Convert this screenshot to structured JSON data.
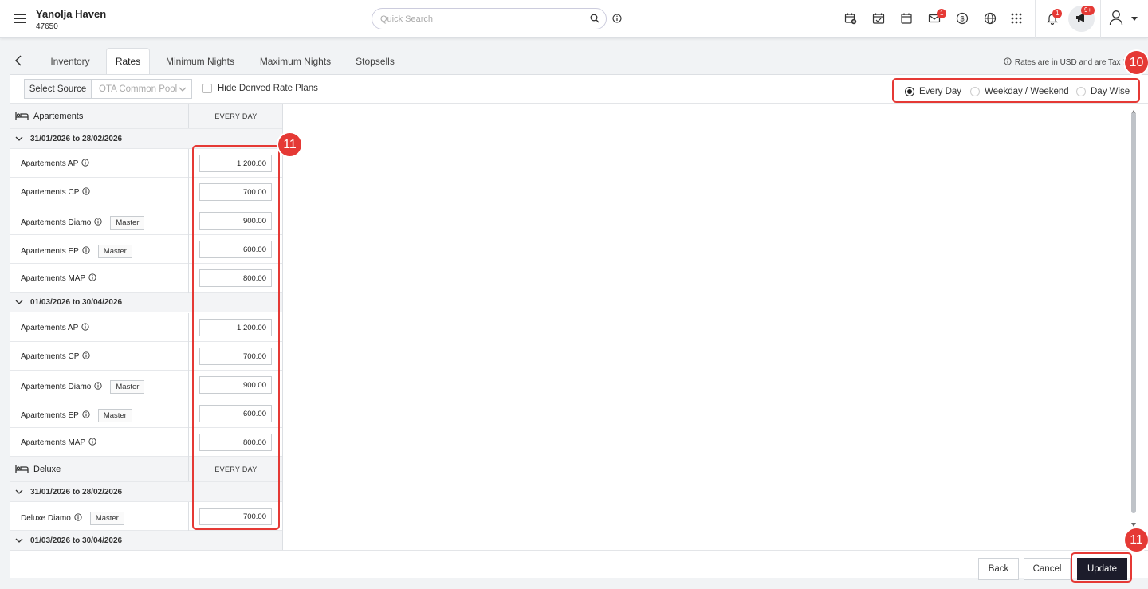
{
  "header": {
    "hotel_name": "Yanolja Haven",
    "hotel_id": "47650",
    "search_placeholder": "Quick Search",
    "mail_badge": "1",
    "notif_badge": "1",
    "announce_badge": "9+"
  },
  "tabs": [
    "Inventory",
    "Rates",
    "Minimum Nights",
    "Maximum Nights",
    "Stopsells"
  ],
  "active_tab": "Rates",
  "note": "Rates are in USD and are Tax Exclusi",
  "filter": {
    "select_source": "Select Source",
    "source_value": "OTA Common Pool",
    "hide_derived": "Hide Derived Rate Plans"
  },
  "radio": {
    "every_day": "Every Day",
    "weekday_weekend": "Weekday / Weekend",
    "day_wise": "Day Wise",
    "selected": "Every Day"
  },
  "grid": {
    "room1": "Apartements",
    "room2": "Deluxe",
    "every_day_header": "EVERY DAY",
    "master": "Master",
    "range1": "31/01/2026 to 28/02/2026",
    "range2": "01/03/2026 to 30/04/2026",
    "plans": [
      {
        "name": "Apartements AP",
        "master": false,
        "value": "1,200.00"
      },
      {
        "name": "Apartements CP",
        "master": false,
        "value": "700.00"
      },
      {
        "name": "Apartements Diamo",
        "master": true,
        "value": "900.00"
      },
      {
        "name": "Apartements EP",
        "master": true,
        "value": "600.00"
      },
      {
        "name": "Apartements MAP",
        "master": false,
        "value": "800.00"
      }
    ],
    "deluxe_plan": {
      "name": "Deluxe Diamo",
      "master": true,
      "value": "700.00"
    }
  },
  "callouts": {
    "radio": "10",
    "inputs": "11",
    "update": "11"
  },
  "footer": {
    "back": "Back",
    "cancel": "Cancel",
    "update": "Update"
  },
  "colors": {
    "accent_red": "#e53935",
    "primary_dark": "#1c1c2b"
  }
}
